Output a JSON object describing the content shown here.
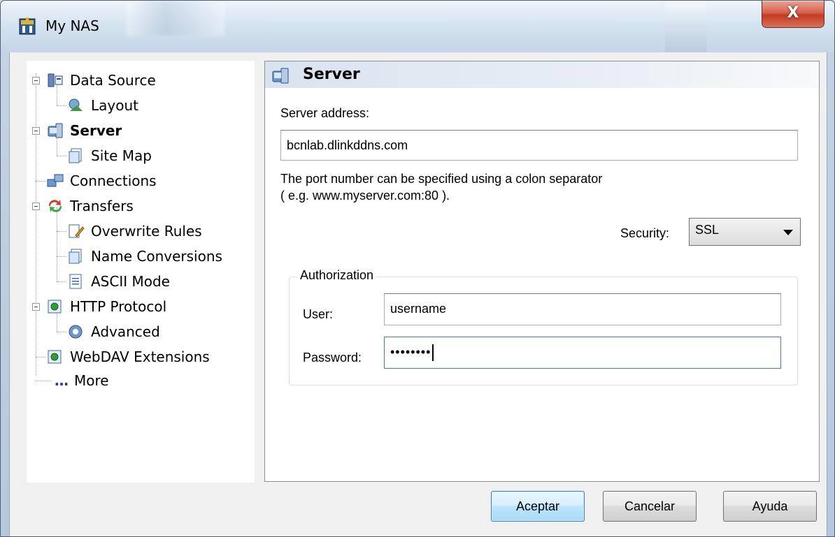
{
  "window": {
    "title": "My NAS",
    "close_label": "X"
  },
  "tree": {
    "items": [
      {
        "label": "Data Source",
        "icon": "data-source-icon"
      },
      {
        "label": "Layout",
        "icon": "layout-icon"
      },
      {
        "label": "Server",
        "icon": "server-icon",
        "selected": true
      },
      {
        "label": "Site Map",
        "icon": "site-map-icon"
      },
      {
        "label": "Connections",
        "icon": "connections-icon"
      },
      {
        "label": "Transfers",
        "icon": "transfers-icon"
      },
      {
        "label": "Overwrite Rules",
        "icon": "overwrite-rules-icon"
      },
      {
        "label": "Name Conversions",
        "icon": "name-conversions-icon"
      },
      {
        "label": "ASCII Mode",
        "icon": "ascii-mode-icon"
      },
      {
        "label": "HTTP Protocol",
        "icon": "http-protocol-icon"
      },
      {
        "label": "Advanced",
        "icon": "advanced-icon"
      },
      {
        "label": "WebDAV Extensions",
        "icon": "webdav-extensions-icon"
      },
      {
        "label": "More",
        "icon": "more-icon"
      }
    ]
  },
  "panel": {
    "title": "Server",
    "server_address_label": "Server address:",
    "server_address_value": "bcnlab.dlinkddns.com",
    "hint_line1": "The port number can be specified using a colon separator",
    "hint_line2": "( e.g. www.myserver.com:80 ).",
    "security_label": "Security:",
    "security_value": "SSL",
    "authorization_legend": "Authorization",
    "user_label": "User:",
    "user_value": "username",
    "password_label": "Password:",
    "password_value": "••••••••"
  },
  "buttons": {
    "ok": "Aceptar",
    "cancel": "Cancelar",
    "help": "Ayuda"
  },
  "colors": {
    "accent": "#3c7fb1",
    "close": "#c33a22"
  }
}
